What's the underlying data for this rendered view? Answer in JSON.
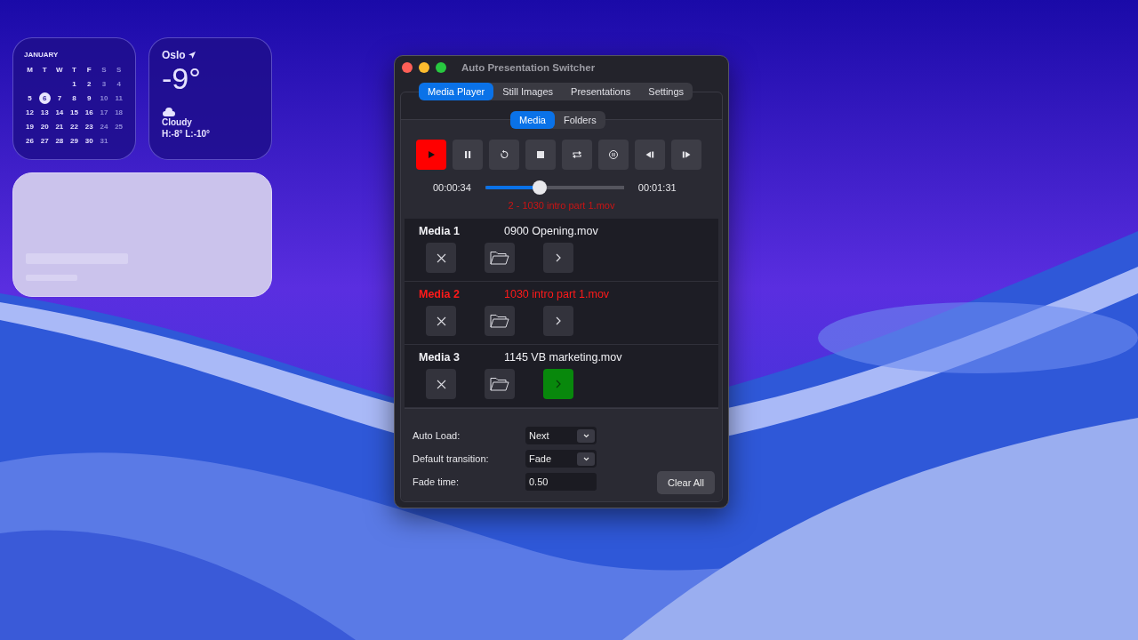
{
  "calendar": {
    "month": "JANUARY",
    "weekdays": [
      "M",
      "T",
      "W",
      "T",
      "F",
      "S",
      "S"
    ],
    "weeks": [
      {
        "days": [
          {
            "d": "1",
            "selected": false
          },
          {
            "d": "2",
            "selected": false
          },
          {
            "d": "3",
            "selected": false
          },
          {
            "d": "4",
            "selected": false
          }
        ]
      },
      {
        "days": [
          {
            "d": "5",
            "selected": false
          },
          {
            "d": "6",
            "selected": true
          },
          {
            "d": "7",
            "selected": false
          },
          {
            "d": "8",
            "selected": false
          },
          {
            "d": "9",
            "selected": false
          },
          {
            "d": "10",
            "selected": false
          },
          {
            "d": "11",
            "selected": false
          }
        ]
      },
      {
        "days": [
          {
            "d": "12",
            "selected": false
          },
          {
            "d": "13",
            "selected": false
          },
          {
            "d": "14",
            "selected": false
          },
          {
            "d": "15",
            "selected": false
          },
          {
            "d": "16",
            "selected": false
          },
          {
            "d": "17",
            "selected": false
          },
          {
            "d": "18",
            "selected": false
          }
        ]
      },
      {
        "days": [
          {
            "d": "19",
            "selected": false
          },
          {
            "d": "20",
            "selected": false
          },
          {
            "d": "21",
            "selected": false
          },
          {
            "d": "22",
            "selected": false
          },
          {
            "d": "23",
            "selected": false
          },
          {
            "d": "24",
            "selected": false
          },
          {
            "d": "25",
            "selected": false
          }
        ]
      },
      {
        "days": [
          {
            "d": "26",
            "selected": false
          },
          {
            "d": "27",
            "selected": false
          },
          {
            "d": "28",
            "selected": false
          },
          {
            "d": "29",
            "selected": false
          },
          {
            "d": "30",
            "selected": false
          },
          {
            "d": "31",
            "selected": false
          }
        ]
      }
    ]
  },
  "weather": {
    "city": "Oslo",
    "temperature": "-9°",
    "condition": "Cloudy",
    "range": "H:-8° L:-10°"
  },
  "window": {
    "title": "Auto Presentation Switcher"
  },
  "tabs": [
    {
      "label": "Media Player",
      "selected": true
    },
    {
      "label": "Still Images",
      "selected": false
    },
    {
      "label": "Presentations",
      "selected": false
    },
    {
      "label": "Settings",
      "selected": false
    }
  ],
  "subtabs": [
    {
      "label": "Media",
      "selected": true
    },
    {
      "label": "Folders",
      "selected": false
    }
  ],
  "transport": [
    {
      "kind": "play",
      "active": true
    },
    {
      "kind": "pause",
      "active": false
    },
    {
      "kind": "restart",
      "active": false
    },
    {
      "kind": "stop",
      "active": false
    },
    {
      "kind": "loop",
      "active": false
    },
    {
      "kind": "hold",
      "active": false
    },
    {
      "kind": "previous",
      "active": false
    },
    {
      "kind": "next",
      "active": false
    }
  ],
  "playback": {
    "elapsed": "00:00:34",
    "level": 0.39,
    "total": "00:01:31",
    "now_playing": "2 - 1030 intro part 1.mov"
  },
  "media": [
    {
      "label": "Media 1",
      "file": "0900 Opening.mov",
      "playing": false,
      "cued": false
    },
    {
      "label": "Media 2",
      "file": "1030 intro part 1.mov",
      "playing": true,
      "cued": false
    },
    {
      "label": "Media 3",
      "file": "1145 VB marketing.mov",
      "playing": false,
      "cued": true
    }
  ],
  "settings": [
    {
      "kind": "select",
      "label": "Auto Load:",
      "value": "Next"
    },
    {
      "kind": "select",
      "label": "Default transition:",
      "value": "Fade"
    },
    {
      "kind": "input",
      "label": "Fade time:",
      "value": "0.50"
    }
  ],
  "clear_button": "Clear All"
}
